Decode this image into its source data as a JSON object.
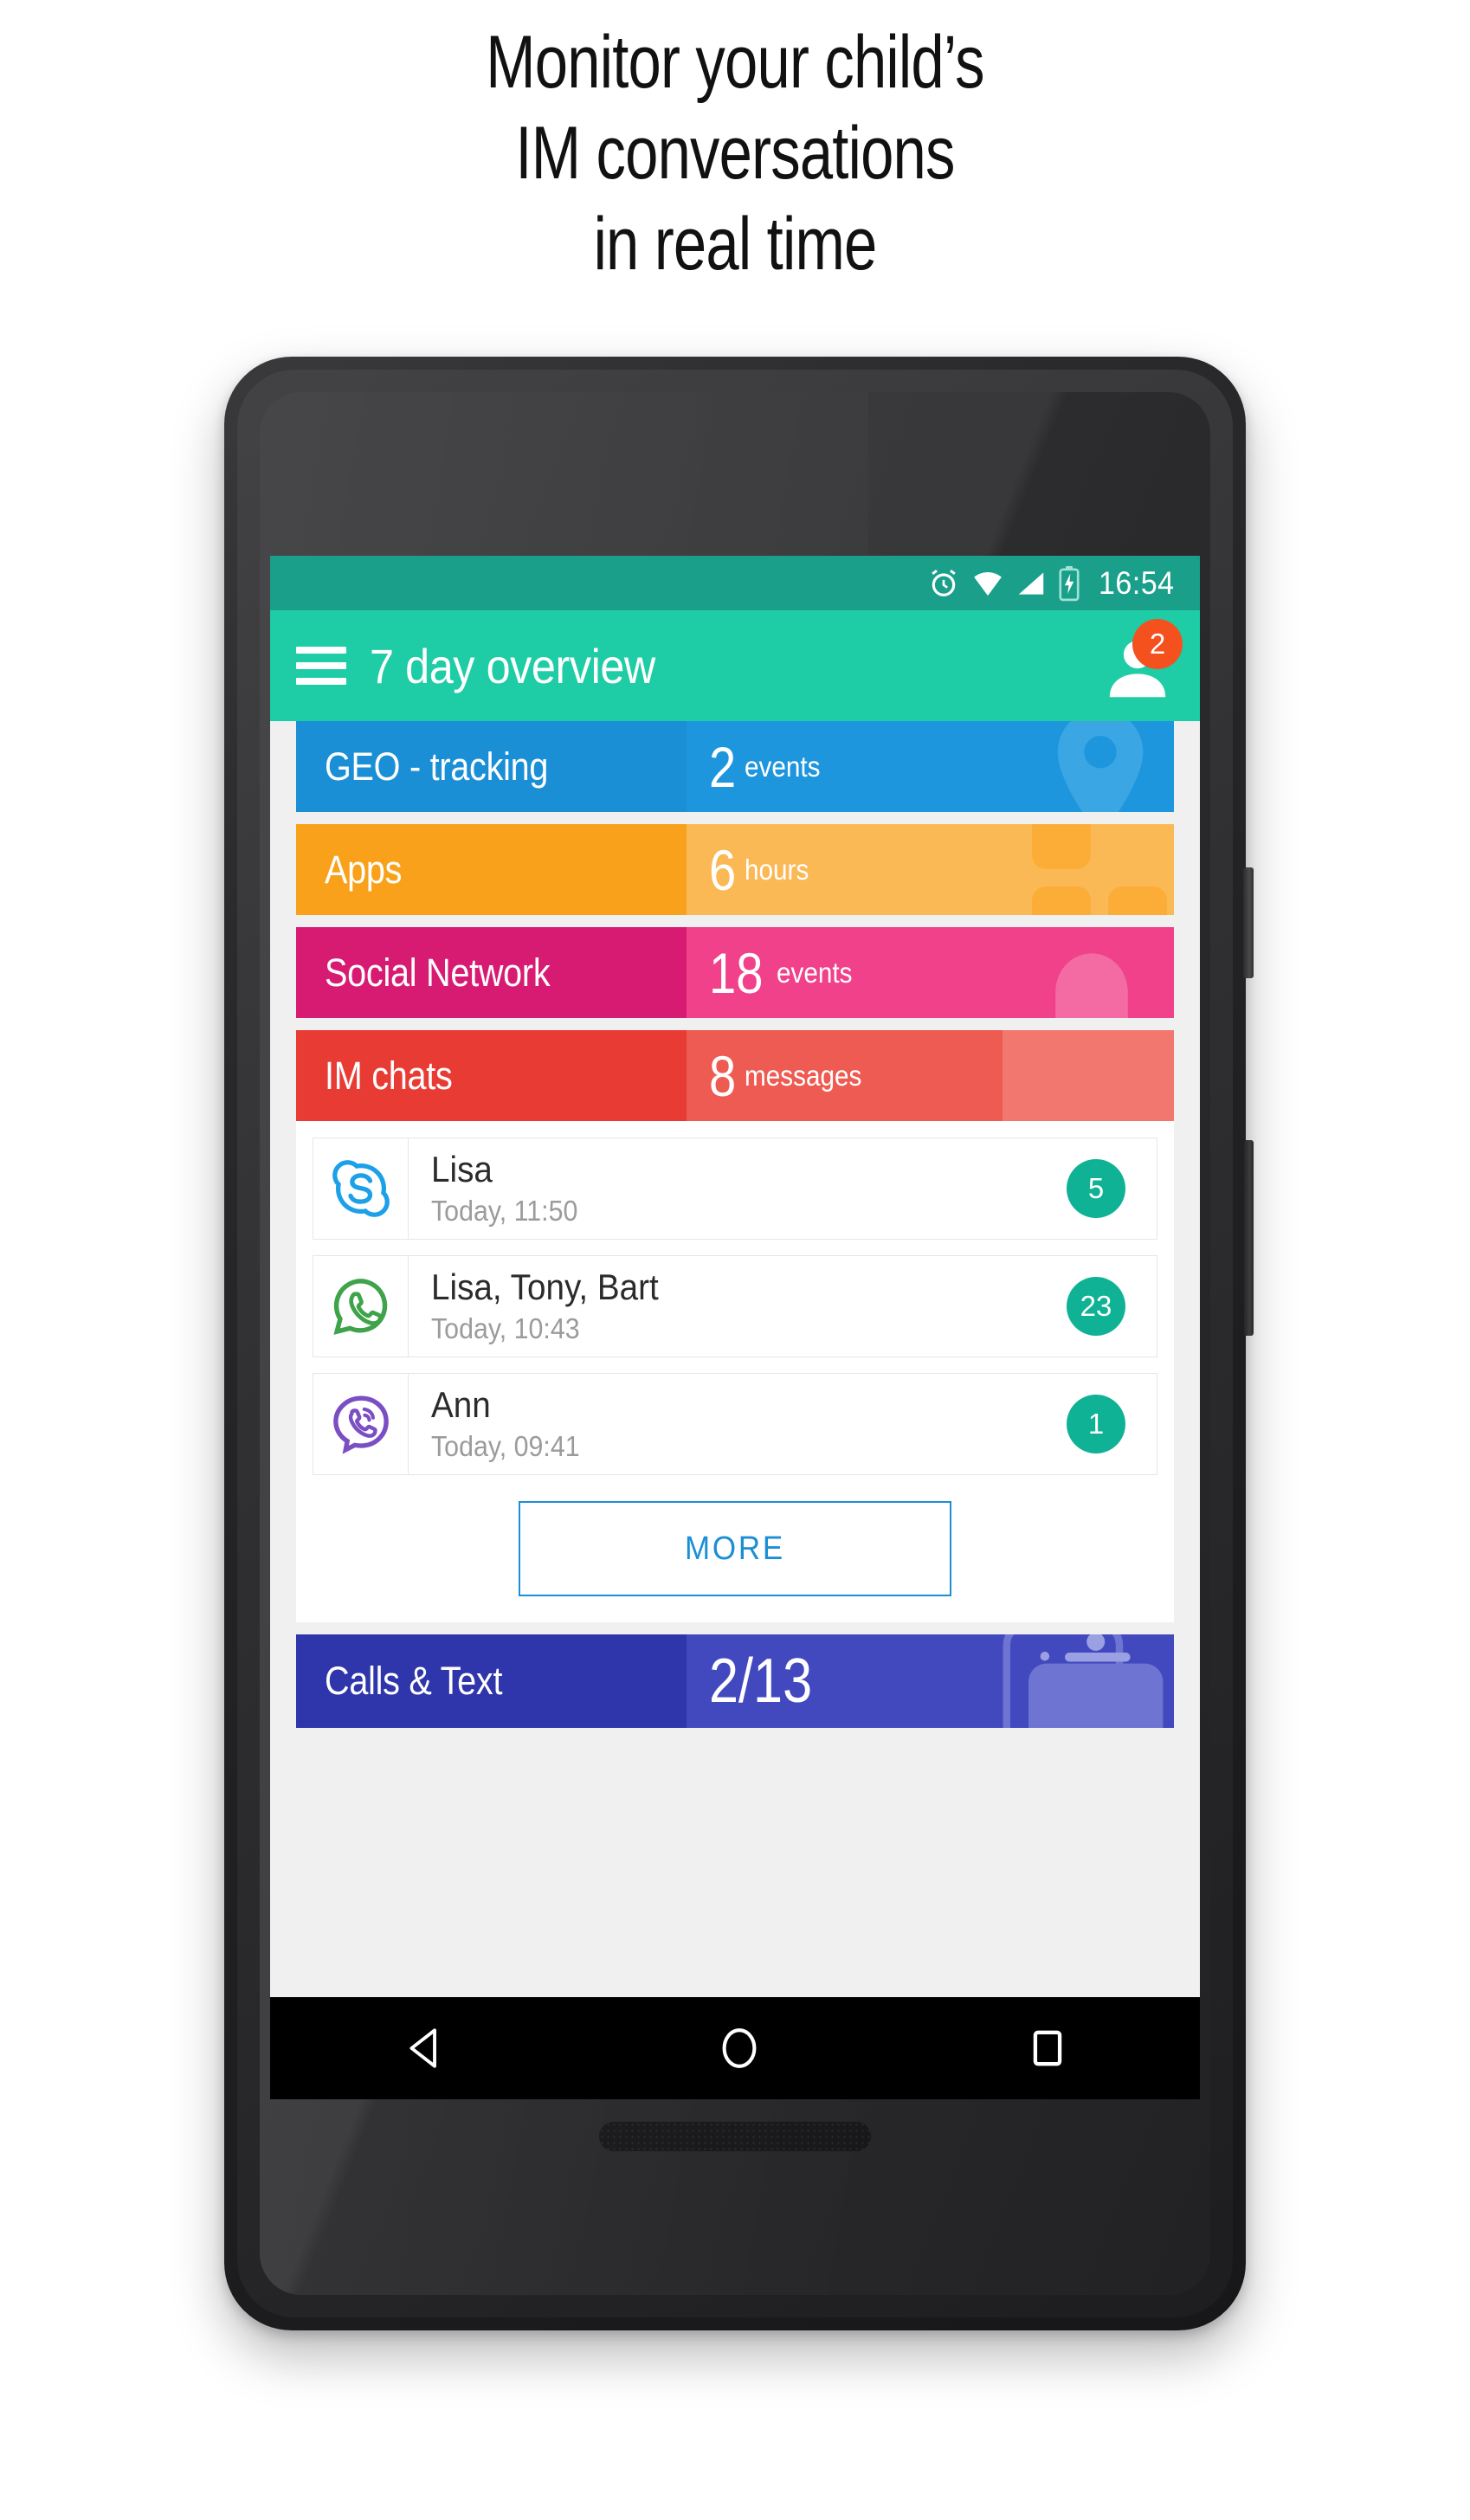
{
  "headline": {
    "line1": "Monitor your child’s",
    "line2": "IM conversations",
    "line3": "in real time"
  },
  "statusbar": {
    "time": "16:54",
    "icons": [
      "alarm-icon",
      "wifi-icon",
      "signal-icon",
      "battery-charging-icon"
    ]
  },
  "appbar": {
    "menu_icon": "hamburger-menu-icon",
    "title": "7 day overview",
    "profile_icon": "person-icon",
    "profile_badge": "2",
    "badge_color": "#f4511e",
    "bar_color": "#1ecca5",
    "status_color": "#199f8a"
  },
  "categories": [
    {
      "label": "GEO - tracking",
      "value": "2",
      "unit": "events",
      "color": "#1b8fd6",
      "color_light": "#1e96dd",
      "watermark": "map-pin-icon"
    },
    {
      "label": "Apps",
      "value": "6",
      "unit": "hours",
      "color": "#f9a11b",
      "color_light": "#fbb956",
      "watermark": "apps-grid-icon"
    },
    {
      "label": "Social Network",
      "value": "18",
      "unit": "events",
      "color": "#d81b72",
      "color_light": "#f0418a",
      "watermark": "bell-icon"
    },
    {
      "label": "IM chats",
      "value": "8",
      "unit": "messages",
      "color": "#e83b33",
      "color_light": "#ee5b52",
      "watermark": "chat-bubble-icon"
    }
  ],
  "im_chats": [
    {
      "app": "skype-icon",
      "app_color": "#1ca0e8",
      "name": "Lisa",
      "time": "Today, 11:50",
      "count": "5"
    },
    {
      "app": "whatsapp-icon",
      "app_color": "#3fa34a",
      "name": "Lisa, Tony, Bart",
      "time": "Today, 10:43",
      "count": "23"
    },
    {
      "app": "viber-icon",
      "app_color": "#7b4ec4",
      "name": "Ann",
      "time": "Today, 09:41",
      "count": "1"
    }
  ],
  "more_button": {
    "label": "MORE",
    "color": "#1b8fd6"
  },
  "calls_row": {
    "label": "Calls & Text",
    "value": "2/13",
    "color": "#2f35ab",
    "color_light": "#4249bf",
    "watermark": "phone-device-icon"
  },
  "badge_color": "#0fb295",
  "navbar": {
    "back": "back-triangle-icon",
    "home": "home-circle-icon",
    "recents": "recents-square-icon"
  }
}
